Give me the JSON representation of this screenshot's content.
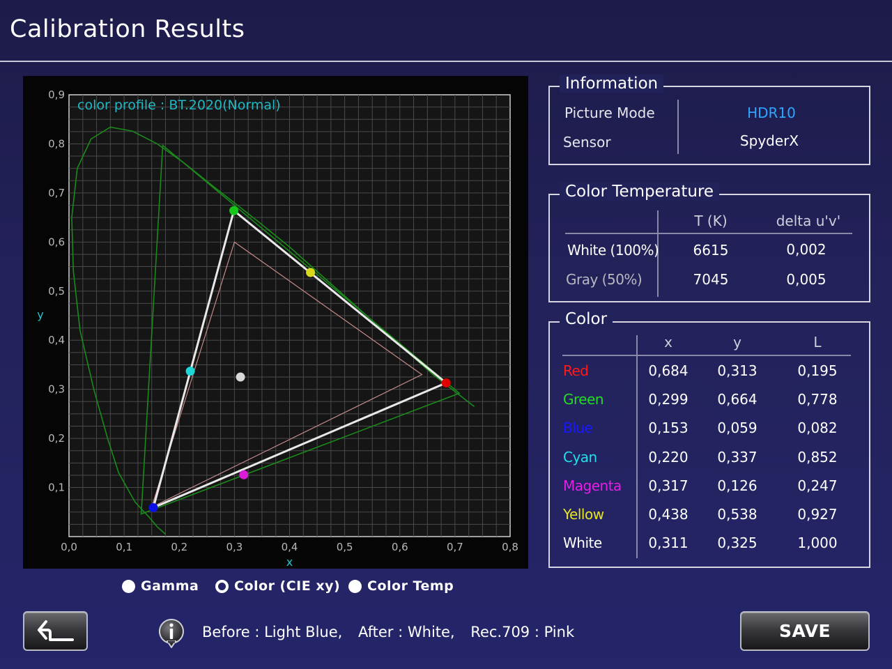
{
  "title": "Calibration Results",
  "chart_data": {
    "type": "scatter",
    "xlabel": "x",
    "ylabel": "y",
    "xlim": [
      0.0,
      0.8
    ],
    "ylim": [
      0.0,
      0.9
    ],
    "x_ticks": [
      "0,0",
      "0,1",
      "0,2",
      "0,3",
      "0,4",
      "0,5",
      "0,6",
      "0,7",
      "0,8"
    ],
    "y_ticks": [
      "0,1",
      "0,2",
      "0,3",
      "0,4",
      "0,5",
      "0,6",
      "0,7",
      "0,8",
      "0,9"
    ],
    "grid": true,
    "profile_label": "color profile :  BT.2020(Normal)",
    "colors": {
      "red": "#e00000",
      "green": "#18c818",
      "blue": "#0a10e6",
      "cyan": "#1cd6d8",
      "magenta": "#d81cd8",
      "yellow": "#d8d81c",
      "white": "#d8d8d8",
      "locus": "#1a8a1a",
      "before": "#36c2d0",
      "after": "#e8e8e8",
      "rec709": "#c48a8a"
    },
    "spectral_locus": [
      [
        0.175,
        0.005
      ],
      [
        0.16,
        0.02
      ],
      [
        0.145,
        0.04
      ],
      [
        0.12,
        0.07
      ],
      [
        0.09,
        0.13
      ],
      [
        0.07,
        0.2
      ],
      [
        0.045,
        0.3
      ],
      [
        0.02,
        0.42
      ],
      [
        0.008,
        0.54
      ],
      [
        0.005,
        0.65
      ],
      [
        0.015,
        0.75
      ],
      [
        0.04,
        0.81
      ],
      [
        0.075,
        0.834
      ],
      [
        0.115,
        0.826
      ],
      [
        0.16,
        0.8
      ],
      [
        0.21,
        0.76
      ],
      [
        0.26,
        0.715
      ],
      [
        0.3,
        0.68
      ],
      [
        0.345,
        0.64
      ],
      [
        0.4,
        0.59
      ],
      [
        0.46,
        0.53
      ],
      [
        0.53,
        0.46
      ],
      [
        0.6,
        0.39
      ],
      [
        0.66,
        0.33
      ],
      [
        0.735,
        0.265
      ]
    ],
    "bt2020_gamut": [
      [
        0.708,
        0.292
      ],
      [
        0.17,
        0.797
      ],
      [
        0.131,
        0.046
      ]
    ],
    "rec709_gamut": [
      [
        0.64,
        0.33
      ],
      [
        0.3,
        0.6
      ],
      [
        0.15,
        0.06
      ]
    ],
    "measured_gamut": [
      [
        0.684,
        0.313
      ],
      [
        0.299,
        0.664
      ],
      [
        0.153,
        0.059
      ]
    ],
    "points": [
      {
        "name": "Red",
        "x": 0.684,
        "y": 0.313
      },
      {
        "name": "Green",
        "x": 0.299,
        "y": 0.664
      },
      {
        "name": "Blue",
        "x": 0.153,
        "y": 0.059
      },
      {
        "name": "Cyan",
        "x": 0.22,
        "y": 0.337
      },
      {
        "name": "Magenta",
        "x": 0.317,
        "y": 0.126
      },
      {
        "name": "Yellow",
        "x": 0.438,
        "y": 0.538
      },
      {
        "name": "White",
        "x": 0.311,
        "y": 0.325
      }
    ]
  },
  "information": {
    "title": "Information",
    "rows": [
      {
        "label": "Picture Mode",
        "value": "HDR10",
        "color": "#2ea6ff"
      },
      {
        "label": "Sensor",
        "value": "SpyderX",
        "color": "#ffffff"
      }
    ]
  },
  "color_temperature": {
    "title": "Color Temperature",
    "headers": [
      "T (K)",
      "delta u'v'"
    ],
    "rows": [
      {
        "label": "White (100%)",
        "t": "6615",
        "delta": "0,002",
        "label_color": "#ffffff"
      },
      {
        "label": "Gray (50%)",
        "t": "7045",
        "delta": "0,005",
        "label_color": "#b8b8c4"
      }
    ]
  },
  "color_table": {
    "title": "Color",
    "headers": [
      "x",
      "y",
      "L"
    ],
    "rows": [
      {
        "label": "Red",
        "x": "0,684",
        "y": "0,313",
        "l": "0,195",
        "color": "#ff1a1a"
      },
      {
        "label": "Green",
        "x": "0,299",
        "y": "0,664",
        "l": "0,778",
        "color": "#22dd22"
      },
      {
        "label": "Blue",
        "x": "0,153",
        "y": "0,059",
        "l": "0,082",
        "color": "#1818ff"
      },
      {
        "label": "Cyan",
        "x": "0,220",
        "y": "0,337",
        "l": "0,852",
        "color": "#22e0e6"
      },
      {
        "label": "Magenta",
        "x": "0,317",
        "y": "0,126",
        "l": "0,247",
        "color": "#e61ee6"
      },
      {
        "label": "Yellow",
        "x": "0,438",
        "y": "0,538",
        "l": "0,927",
        "color": "#e6e61e"
      },
      {
        "label": "White",
        "x": "0,311",
        "y": "0,325",
        "l": "1,000",
        "color": "#ffffff"
      }
    ]
  },
  "view_options": [
    {
      "label": "Gamma",
      "selected": false
    },
    {
      "label": "Color (CIE xy)",
      "selected": true
    },
    {
      "label": "Color Temp",
      "selected": false
    }
  ],
  "legend_note": {
    "before": "Before : Light Blue,",
    "after": "After : White,",
    "rec709": "Rec.709 : Pink"
  },
  "buttons": {
    "back_icon": "return-arrow-icon",
    "save_label": "SAVE"
  }
}
